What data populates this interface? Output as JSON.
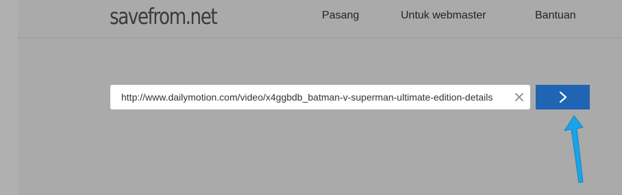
{
  "header": {
    "logo_text": "savefrom.net",
    "nav": [
      {
        "label": "Pasang"
      },
      {
        "label": "Untuk webmaster"
      },
      {
        "label": "Bantuan"
      }
    ]
  },
  "search": {
    "value": "http://www.dailymotion.com/video/x4ggbdb_batman-v-superman-ultimate-edition-details",
    "clear_icon": "close-icon",
    "submit_icon": "chevron-right-icon"
  },
  "annotation": {
    "icon": "arrow-up-icon",
    "color": "#1aa3e8"
  },
  "colors": {
    "background": "#aaaaaa",
    "submit_button": "#1f65b4",
    "input_background": "#ffffff"
  }
}
